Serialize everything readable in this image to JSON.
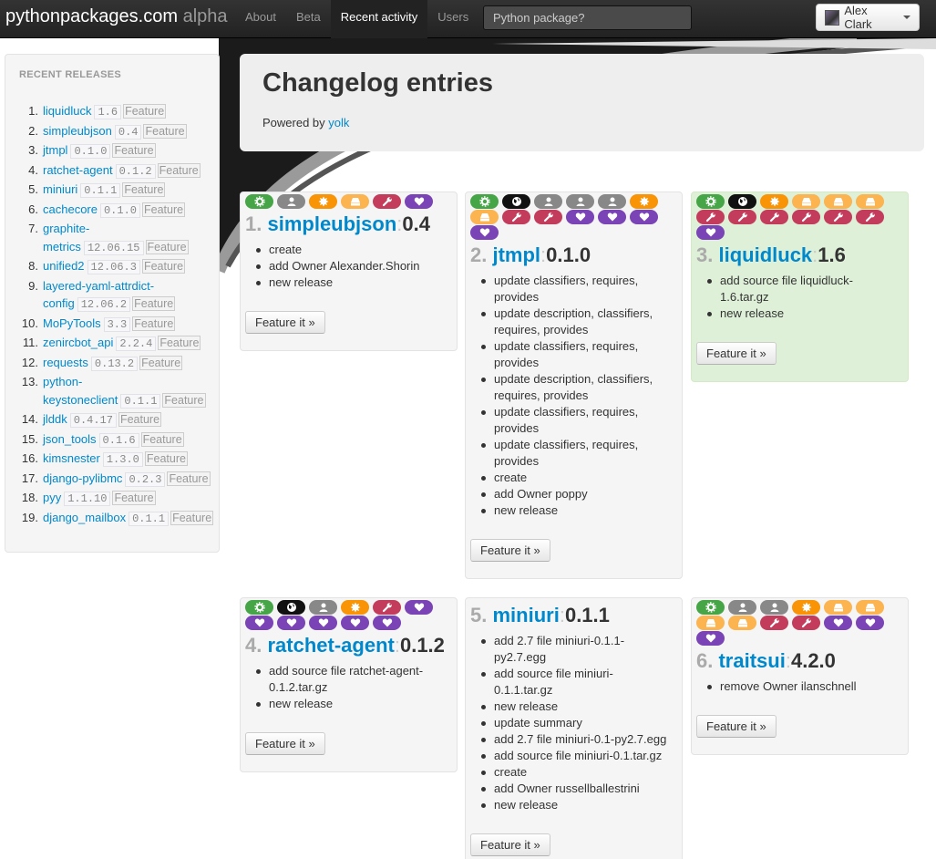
{
  "brand": {
    "name": "pythonpackages.com",
    "tag": "alpha"
  },
  "nav": [
    {
      "label": "About",
      "active": false
    },
    {
      "label": "Beta",
      "active": false
    },
    {
      "label": "Recent activity",
      "active": true
    },
    {
      "label": "Users",
      "active": false
    }
  ],
  "search": {
    "placeholder": "Python package?"
  },
  "user": {
    "name": "Alex Clark"
  },
  "sidebar": {
    "heading": "RECENT RELEASES",
    "feature_label": "Feature",
    "items": [
      {
        "num": "1.",
        "name": "liquidluck",
        "version": "1.6"
      },
      {
        "num": "2.",
        "name": "simpleubjson",
        "version": "0.4"
      },
      {
        "num": "3.",
        "name": "jtmpl",
        "version": "0.1.0"
      },
      {
        "num": "4.",
        "name": "ratchet-agent",
        "version": "0.1.2"
      },
      {
        "num": "5.",
        "name": "miniuri",
        "version": "0.1.1"
      },
      {
        "num": "6.",
        "name": "cachecore",
        "version": "0.1.0"
      },
      {
        "num": "7.",
        "name": "graphite-metrics",
        "version": "12.06.15"
      },
      {
        "num": "8.",
        "name": "unified2",
        "version": "12.06.3"
      },
      {
        "num": "9.",
        "name": "layered-yaml-attrdict-config",
        "version": "12.06.2"
      },
      {
        "num": "10.",
        "name": "MoPyTools",
        "version": "3.3"
      },
      {
        "num": "11.",
        "name": "zenircbot_api",
        "version": "2.2.4"
      },
      {
        "num": "12.",
        "name": "requests",
        "version": "0.13.2"
      },
      {
        "num": "13.",
        "name": "python-keystoneclient",
        "version": "0.1.1"
      },
      {
        "num": "14.",
        "name": "jlddk",
        "version": "0.4.17"
      },
      {
        "num": "15.",
        "name": "json_tools",
        "version": "0.1.6"
      },
      {
        "num": "16.",
        "name": "kimsnester",
        "version": "1.3.0"
      },
      {
        "num": "17.",
        "name": "django-pylibmc",
        "version": "0.2.3"
      },
      {
        "num": "18.",
        "name": "pyy",
        "version": "1.1.10"
      },
      {
        "num": "19.",
        "name": "django_mailbox",
        "version": "0.1.1"
      }
    ]
  },
  "hero": {
    "title": "Changelog entries",
    "powered_prefix": "Powered by ",
    "powered_link": "yolk"
  },
  "icon_colors": {
    "green": "#46a546",
    "black": "#111111",
    "gray": "#888888",
    "orange": "#f89406",
    "yellow": "#fbb450",
    "red": "#c43c5b",
    "purple": "#7a43b6"
  },
  "cards": [
    {
      "num": "1.",
      "name": "simpleubjson",
      "version": "0.4",
      "highlight": false,
      "icons": [
        [
          "gear-icon",
          "green"
        ],
        [
          "user-icon",
          "gray"
        ],
        [
          "badge-icon",
          "orange"
        ],
        [
          "hdd-icon",
          "yellow"
        ],
        [
          "wrench-icon",
          "red"
        ],
        [
          "heart-icon",
          "purple"
        ]
      ],
      "changes": [
        "create",
        "add Owner Alexander.Shorin",
        "new release"
      ],
      "button": "Feature it »"
    },
    {
      "num": "2.",
      "name": "jtmpl",
      "version": "0.1.0",
      "highlight": false,
      "icons": [
        [
          "gear-icon",
          "green"
        ],
        [
          "globe-icon",
          "black"
        ],
        [
          "user-icon",
          "gray"
        ],
        [
          "user-icon",
          "gray"
        ],
        [
          "user-icon",
          "gray"
        ],
        [
          "badge-icon",
          "orange"
        ],
        [
          "hdd-icon",
          "yellow"
        ],
        [
          "wrench-icon",
          "red"
        ],
        [
          "wrench-icon",
          "red"
        ],
        [
          "heart-icon",
          "purple"
        ],
        [
          "heart-icon",
          "purple"
        ],
        [
          "heart-icon",
          "purple"
        ],
        [
          "heart-icon",
          "purple"
        ]
      ],
      "changes": [
        "update classifiers, requires, provides",
        "update description, classifiers, requires, provides",
        "update classifiers, requires, provides",
        "update description, classifiers, requires, provides",
        "update classifiers, requires, provides",
        "update classifiers, requires, provides",
        "create",
        "add Owner poppy",
        "new release"
      ],
      "button": "Feature it »"
    },
    {
      "num": "3.",
      "name": "liquidluck",
      "version": "1.6",
      "highlight": true,
      "icons": [
        [
          "gear-icon",
          "green"
        ],
        [
          "globe-icon",
          "black"
        ],
        [
          "badge-icon",
          "orange"
        ],
        [
          "hdd-icon",
          "yellow"
        ],
        [
          "hdd-icon",
          "yellow"
        ],
        [
          "hdd-icon",
          "yellow"
        ],
        [
          "wrench-icon",
          "red"
        ],
        [
          "wrench-icon",
          "red"
        ],
        [
          "wrench-icon",
          "red"
        ],
        [
          "wrench-icon",
          "red"
        ],
        [
          "wrench-icon",
          "red"
        ],
        [
          "wrench-icon",
          "red"
        ],
        [
          "heart-icon",
          "purple"
        ]
      ],
      "changes": [
        "add source file liquidluck-1.6.tar.gz",
        "new release"
      ],
      "button": "Feature it »"
    },
    {
      "num": "4.",
      "name": "ratchet-agent",
      "version": "0.1.2",
      "highlight": false,
      "icons": [
        [
          "gear-icon",
          "green"
        ],
        [
          "globe-icon",
          "black"
        ],
        [
          "user-icon",
          "gray"
        ],
        [
          "badge-icon",
          "orange"
        ],
        [
          "wrench-icon",
          "red"
        ],
        [
          "heart-icon",
          "purple"
        ],
        [
          "heart-icon",
          "purple"
        ],
        [
          "heart-icon",
          "purple"
        ],
        [
          "heart-icon",
          "purple"
        ],
        [
          "heart-icon",
          "purple"
        ],
        [
          "heart-icon",
          "purple"
        ]
      ],
      "changes": [
        "add source file ratchet-agent-0.1.2.tar.gz",
        "new release"
      ],
      "button": "Feature it »"
    },
    {
      "num": "5.",
      "name": "miniuri",
      "version": "0.1.1",
      "highlight": false,
      "icons": [],
      "changes": [
        "add 2.7 file miniuri-0.1.1-py2.7.egg",
        "add source file miniuri-0.1.1.tar.gz",
        "new release",
        "update summary",
        "add 2.7 file miniuri-0.1-py2.7.egg",
        "add source file miniuri-0.1.tar.gz",
        "create",
        "add Owner russellballestrini",
        "new release"
      ],
      "button": "Feature it »"
    },
    {
      "num": "6.",
      "name": "traitsui",
      "version": "4.2.0",
      "highlight": false,
      "icons": [
        [
          "gear-icon",
          "green"
        ],
        [
          "user-icon",
          "gray"
        ],
        [
          "user-icon",
          "gray"
        ],
        [
          "badge-icon",
          "orange"
        ],
        [
          "hdd-icon",
          "yellow"
        ],
        [
          "hdd-icon",
          "yellow"
        ],
        [
          "hdd-icon",
          "yellow"
        ],
        [
          "hdd-icon",
          "yellow"
        ],
        [
          "wrench-icon",
          "red"
        ],
        [
          "wrench-icon",
          "red"
        ],
        [
          "heart-icon",
          "purple"
        ],
        [
          "heart-icon",
          "purple"
        ],
        [
          "heart-icon",
          "purple"
        ]
      ],
      "changes": [
        "remove Owner ilanschnell"
      ],
      "button": "Feature it »"
    }
  ]
}
